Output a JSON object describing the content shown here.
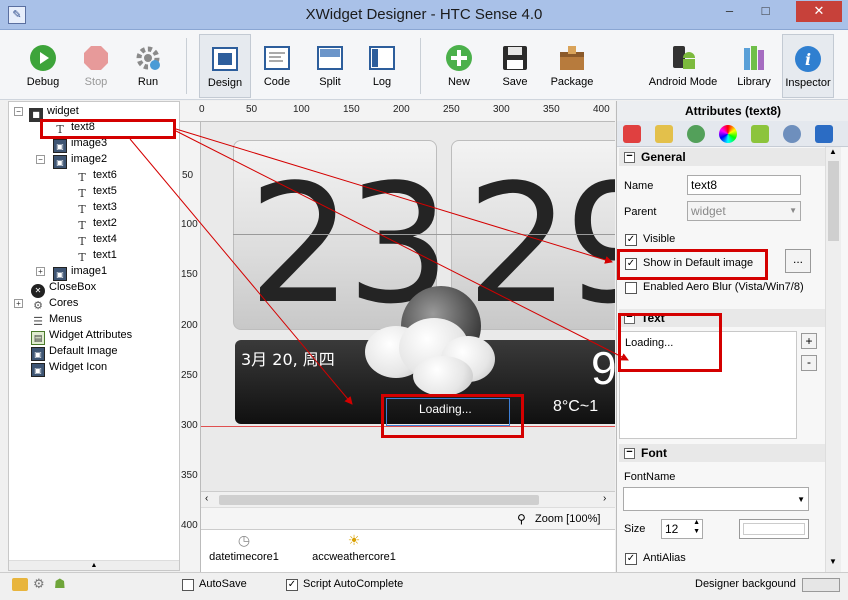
{
  "window": {
    "title": "XWidget Designer - HTC Sense 4.0",
    "min": "–",
    "max": "□",
    "close": "✕"
  },
  "toolbar": {
    "debug": "Debug",
    "stop": "Stop",
    "run": "Run",
    "design": "Design",
    "code": "Code",
    "split": "Split",
    "log": "Log",
    "new": "New",
    "save": "Save",
    "package": "Package",
    "android": "Android Mode",
    "library": "Library",
    "inspector": "Inspector"
  },
  "tree": {
    "items": [
      {
        "label": "widget"
      },
      {
        "label": "text8"
      },
      {
        "label": "image3"
      },
      {
        "label": "image2"
      },
      {
        "label": "text6"
      },
      {
        "label": "text5"
      },
      {
        "label": "text3"
      },
      {
        "label": "text2"
      },
      {
        "label": "text4"
      },
      {
        "label": "text1"
      },
      {
        "label": "image1"
      },
      {
        "label": "CloseBox"
      },
      {
        "label": "Cores"
      },
      {
        "label": "Menus"
      },
      {
        "label": "Widget Attributes"
      },
      {
        "label": "Default Image"
      },
      {
        "label": "Widget Icon"
      }
    ]
  },
  "ruler": {
    "top": [
      "0",
      "50",
      "100",
      "150",
      "200",
      "250",
      "300",
      "350",
      "400"
    ],
    "left": [
      "50",
      "100",
      "150",
      "200",
      "250",
      "300",
      "350",
      "400"
    ]
  },
  "preview": {
    "hour": "23",
    "minute": "29",
    "date": "3月 20, 周四",
    "temp_big": "9",
    "temp_range": "8°C~1",
    "loading": "Loading..."
  },
  "zoom": {
    "label": "Zoom [100%]"
  },
  "cores": [
    {
      "label": "datetimecore1"
    },
    {
      "label": "accweathercore1"
    }
  ],
  "inspector": {
    "title": "Attributes (text8)",
    "general": {
      "header": "General",
      "name_label": "Name",
      "name_value": "text8",
      "parent_label": "Parent",
      "parent_value": "widget",
      "visible": "Visible",
      "show_default": "Show in Default image",
      "ellipsis": "...",
      "aero": "Enabled Aero Blur (Vista/Win7/8)"
    },
    "text": {
      "header": "Text",
      "value": "Loading...",
      "plus": "+",
      "minus": "-"
    },
    "font": {
      "header": "Font",
      "fontname_label": "FontName",
      "size_label": "Size",
      "size_value": "12",
      "antialias": "AntiAlias"
    }
  },
  "status": {
    "autosave": "AutoSave",
    "autocomplete": "Script AutoComplete",
    "background": "Designer backgound"
  },
  "colors": {
    "annotation": "#d40000",
    "titlebar": "#a9c1e8",
    "close": "#c7413a"
  }
}
